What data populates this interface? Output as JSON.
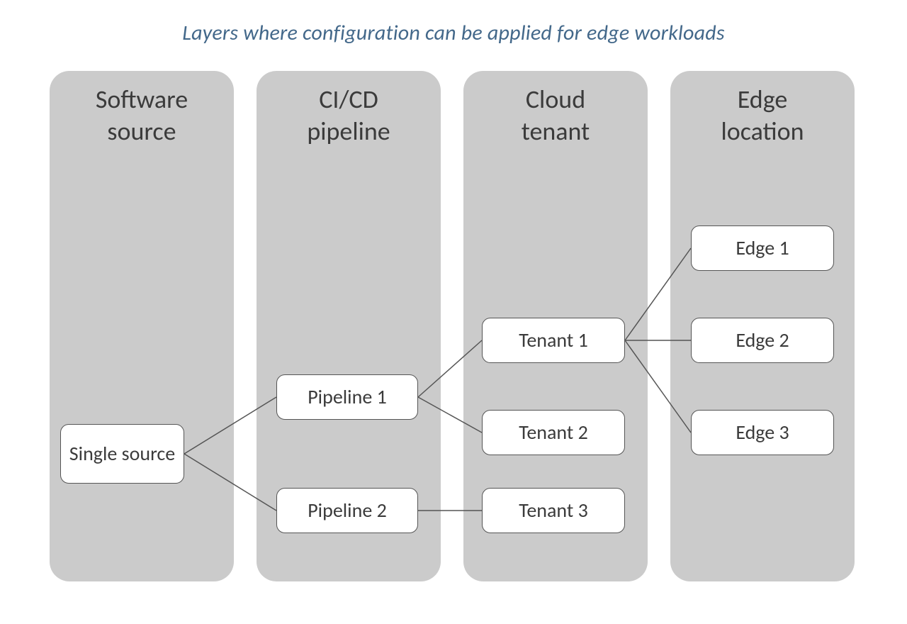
{
  "title": "Layers where configuration can be applied for edge workloads",
  "columns": {
    "c0": {
      "line1": "Software",
      "line2": "source"
    },
    "c1": {
      "line1": "CI/CD",
      "line2": "pipeline"
    },
    "c2": {
      "line1": "Cloud",
      "line2": "tenant"
    },
    "c3": {
      "line1": "Edge",
      "line2": "location"
    }
  },
  "nodes": {
    "source": "Single source",
    "pipeline1": "Pipeline 1",
    "pipeline2": "Pipeline 2",
    "tenant1": "Tenant 1",
    "tenant2": "Tenant 2",
    "tenant3": "Tenant 3",
    "edge1": "Edge 1",
    "edge2": "Edge 2",
    "edge3": "Edge 3"
  },
  "edges": [
    [
      "source",
      "pipeline1"
    ],
    [
      "source",
      "pipeline2"
    ],
    [
      "pipeline1",
      "tenant1"
    ],
    [
      "pipeline1",
      "tenant2"
    ],
    [
      "pipeline2",
      "tenant3"
    ],
    [
      "tenant1",
      "edge1"
    ],
    [
      "tenant1",
      "edge2"
    ],
    [
      "tenant1",
      "edge3"
    ]
  ],
  "colors": {
    "title": "#43688a",
    "columnBg": "#cbcbcb",
    "nodeBorder": "#555555",
    "text": "#3b3b3b"
  }
}
